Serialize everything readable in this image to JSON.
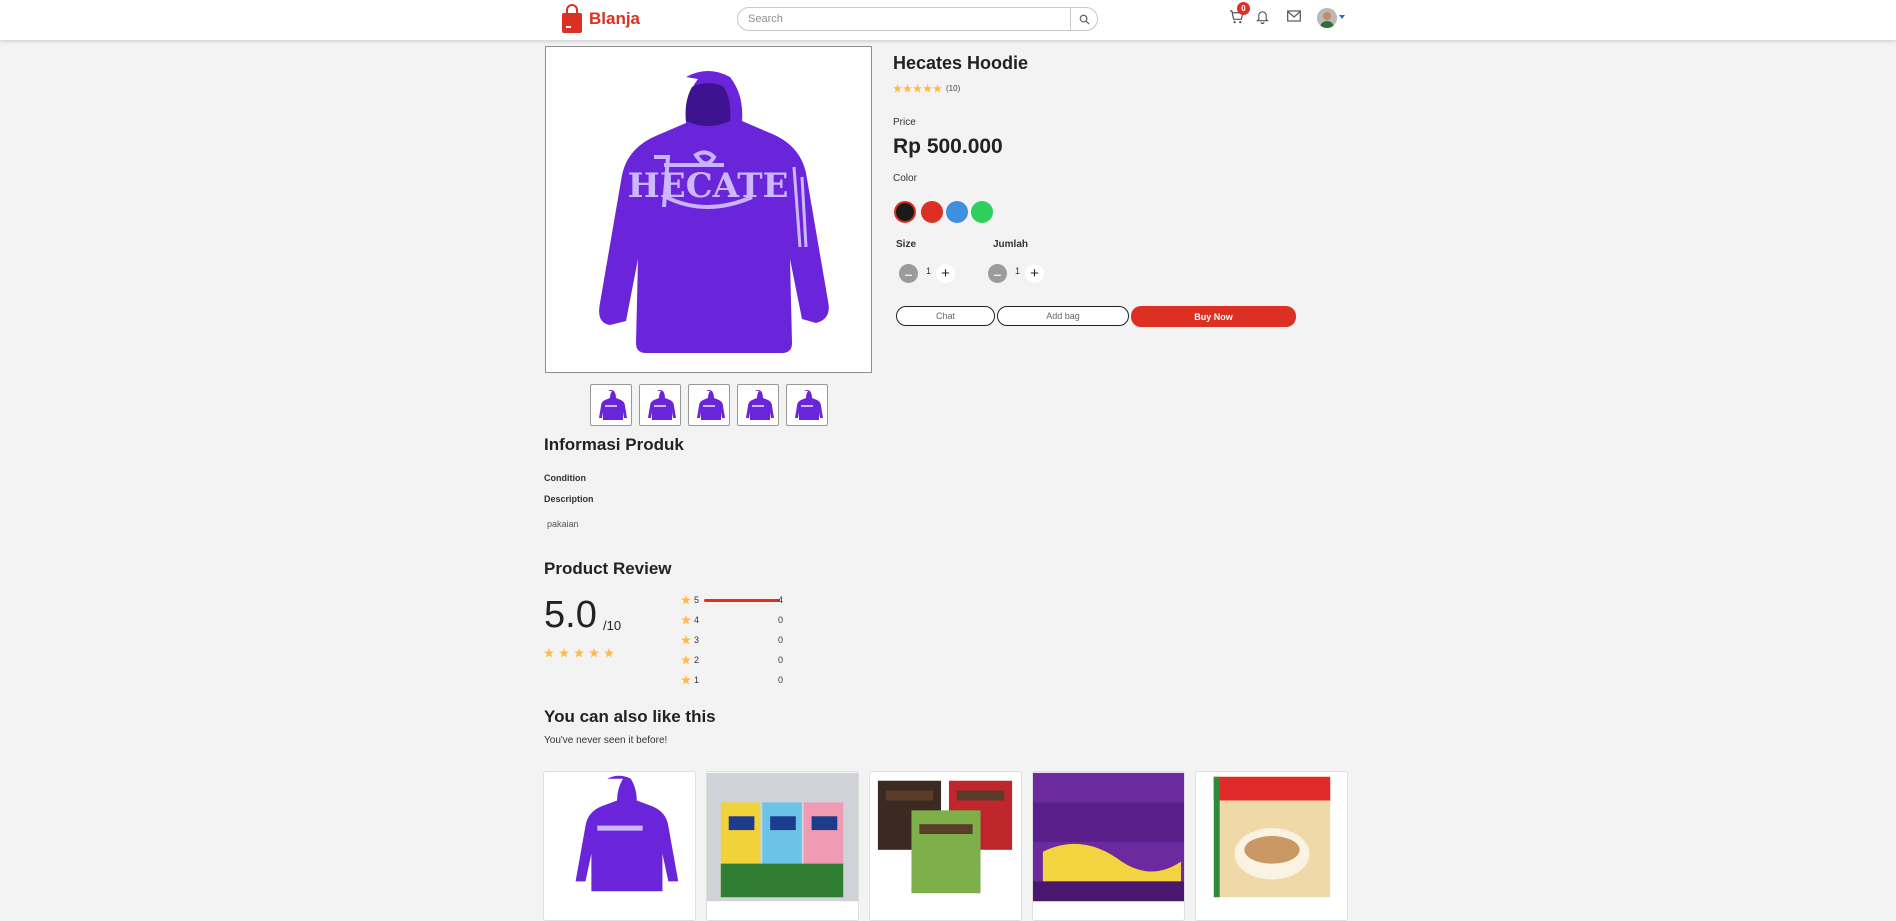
{
  "navbar": {
    "logo_text": "Blanja",
    "search_placeholder": "Search",
    "cart_badge": "0"
  },
  "product": {
    "title": "Hecates Hoodie",
    "rating_count": "(10)",
    "price_label": "Price",
    "price_value": "Rp 500.000",
    "color_label": "Color",
    "colors": [
      "#1a1a1a",
      "#db3022",
      "#3d8fe0",
      "#2fcf5e"
    ],
    "size_label": "Size",
    "size_value": "1",
    "qty_label": "Jumlah",
    "qty_value": "1",
    "chat_label": "Chat",
    "addbag_label": "Add bag",
    "buy_label": "Buy Now",
    "image_color": "#6a24d9"
  },
  "info": {
    "heading": "Informasi Produk",
    "condition_label": "Condition",
    "description_label": "Description",
    "description_text": "pakaian"
  },
  "review": {
    "heading": "Product Review",
    "score": "5.0",
    "score_suffix": "/10",
    "stars_shown": 5,
    "bars": [
      {
        "stars": "5",
        "count": "4",
        "fill": 1.0
      },
      {
        "stars": "4",
        "count": "0",
        "fill": 0
      },
      {
        "stars": "3",
        "count": "0",
        "fill": 0
      },
      {
        "stars": "2",
        "count": "0",
        "fill": 0
      },
      {
        "stars": "1",
        "count": "0",
        "fill": 0
      }
    ]
  },
  "recommend": {
    "heading": "You can also like this",
    "subheading": "You've never seen it before!"
  },
  "colors": {
    "brand": "#db3022",
    "star": "#ffba49"
  }
}
